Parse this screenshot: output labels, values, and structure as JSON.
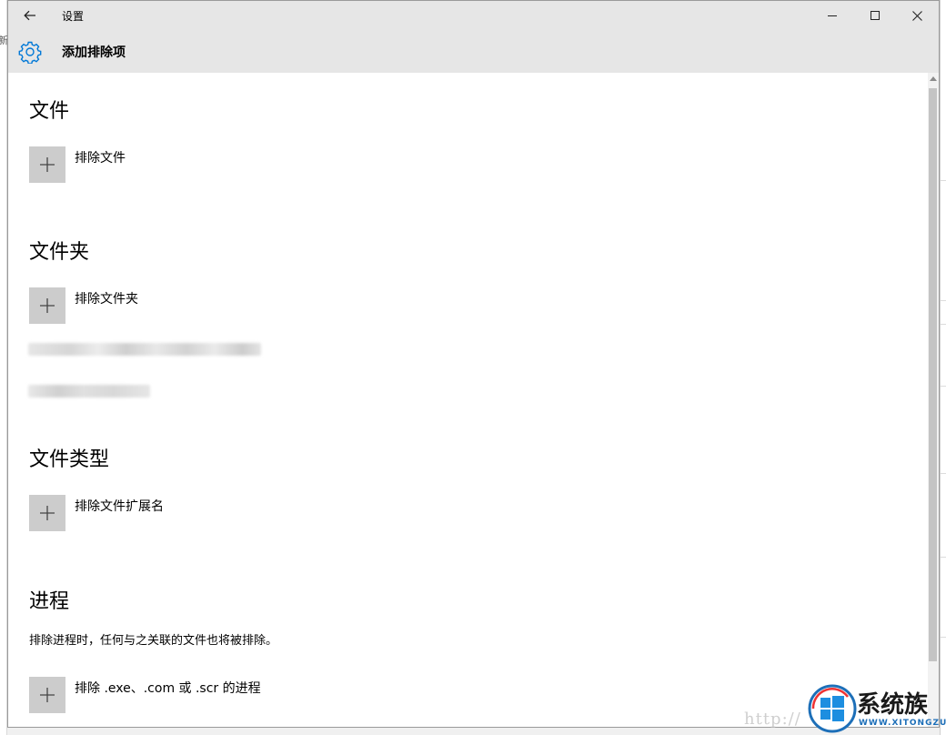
{
  "window": {
    "title": "设置",
    "page_title": "添加排除项"
  },
  "sections": {
    "files": {
      "heading": "文件",
      "add_label": "排除文件"
    },
    "folders": {
      "heading": "文件夹",
      "add_label": "排除文件夹"
    },
    "file_types": {
      "heading": "文件类型",
      "add_label": "排除文件扩展名"
    },
    "processes": {
      "heading": "进程",
      "description": "排除进程时，任何与之关联的文件也将被排除。",
      "add_label": "排除 .exe、.com 或 .scr 的进程"
    }
  },
  "background": {
    "left_text": "新"
  },
  "watermark": {
    "url_text": "http://",
    "logo_text": "系统族",
    "logo_sub": "WWW.XITONGZU.COM"
  },
  "icons": {
    "back": "back-arrow-icon",
    "minimize": "minimize-icon",
    "maximize": "maximize-icon",
    "close": "close-icon",
    "settings": "gear-icon",
    "add": "plus-icon"
  },
  "colors": {
    "accent": "#0078d7",
    "titlebar": "#e6e6e6",
    "tile": "#cccccc"
  }
}
